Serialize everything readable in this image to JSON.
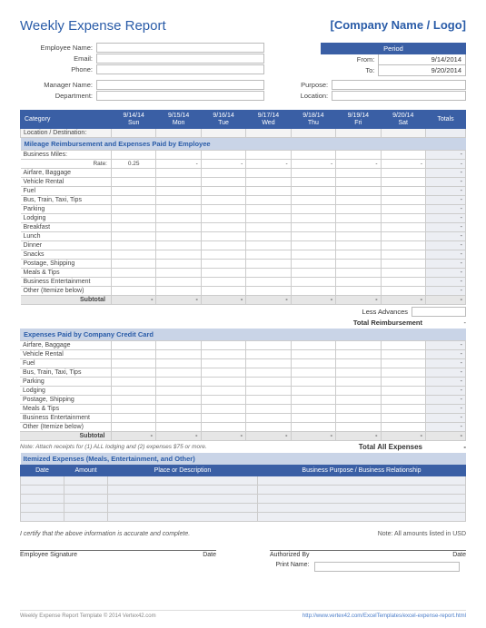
{
  "title": "Weekly Expense Report",
  "company_placeholder": "[Company Name / Logo]",
  "employee_fields": {
    "name": "Employee Name:",
    "email": "Email:",
    "phone": "Phone:",
    "manager": "Manager Name:",
    "dept": "Department:"
  },
  "right_fields": {
    "purpose": "Purpose:",
    "location": "Location:"
  },
  "period": {
    "header": "Period",
    "from_label": "From:",
    "to_label": "To:",
    "from_value": "9/14/2014",
    "to_value": "9/20/2014"
  },
  "grid": {
    "category": "Category",
    "days": [
      {
        "date": "9/14/14",
        "dow": "Sun"
      },
      {
        "date": "9/15/14",
        "dow": "Mon"
      },
      {
        "date": "9/16/14",
        "dow": "Tue"
      },
      {
        "date": "9/17/14",
        "dow": "Wed"
      },
      {
        "date": "9/18/14",
        "dow": "Thu"
      },
      {
        "date": "9/19/14",
        "dow": "Fri"
      },
      {
        "date": "9/20/14",
        "dow": "Sat"
      }
    ],
    "totals": "Totals",
    "location_row": "Location / Destination:",
    "section1": "Mileage Reimbursement and Expenses Paid by Employee",
    "business_miles": "Business Miles:",
    "rate_label": "Rate:",
    "rate_value": "0.25",
    "rows1": [
      "Airfare, Baggage",
      "Vehicle Rental",
      "Fuel",
      "Bus, Train, Taxi, Tips",
      "Parking",
      "Lodging",
      "Breakfast",
      "Lunch",
      "Dinner",
      "Snacks",
      "Postage, Shipping",
      "Meals & Tips",
      "Business Entertainment",
      "Other (Itemize below)"
    ],
    "subtotal": "Subtotal",
    "less_advances": "Less Advances",
    "total_reimbursement": "Total Reimbursement",
    "section2": "Expenses Paid by Company Credit Card",
    "rows2": [
      "Airfare, Baggage",
      "Vehicle Rental",
      "Fuel",
      "Bus, Train, Taxi, Tips",
      "Parking",
      "Lodging",
      "Postage, Shipping",
      "Meals & Tips",
      "Business Entertainment",
      "Other (Itemize below)"
    ],
    "note": "Note: Attach receipts for (1) ALL lodging and (2) expenses $75 or more.",
    "total_all": "Total All Expenses"
  },
  "itemized": {
    "header": "Itemized Expenses (Meals, Entertainment, and Other)",
    "cols": [
      "Date",
      "Amount",
      "Place or Description",
      "Business Purpose / Business Relationship"
    ],
    "rows": 5
  },
  "cert": "I certify that the above information is accurate and complete.",
  "cert_note": "Note: All amounts listed in USD",
  "sig": {
    "emp": "Employee Signature",
    "date": "Date",
    "auth": "Authorized By",
    "print": "Print Name:"
  },
  "footer": {
    "left": "Weekly Expense Report Template © 2014 Vertex42.com",
    "right": "http://www.vertex42.com/ExcelTemplates/excel-expense-report.html"
  },
  "dash": "-"
}
